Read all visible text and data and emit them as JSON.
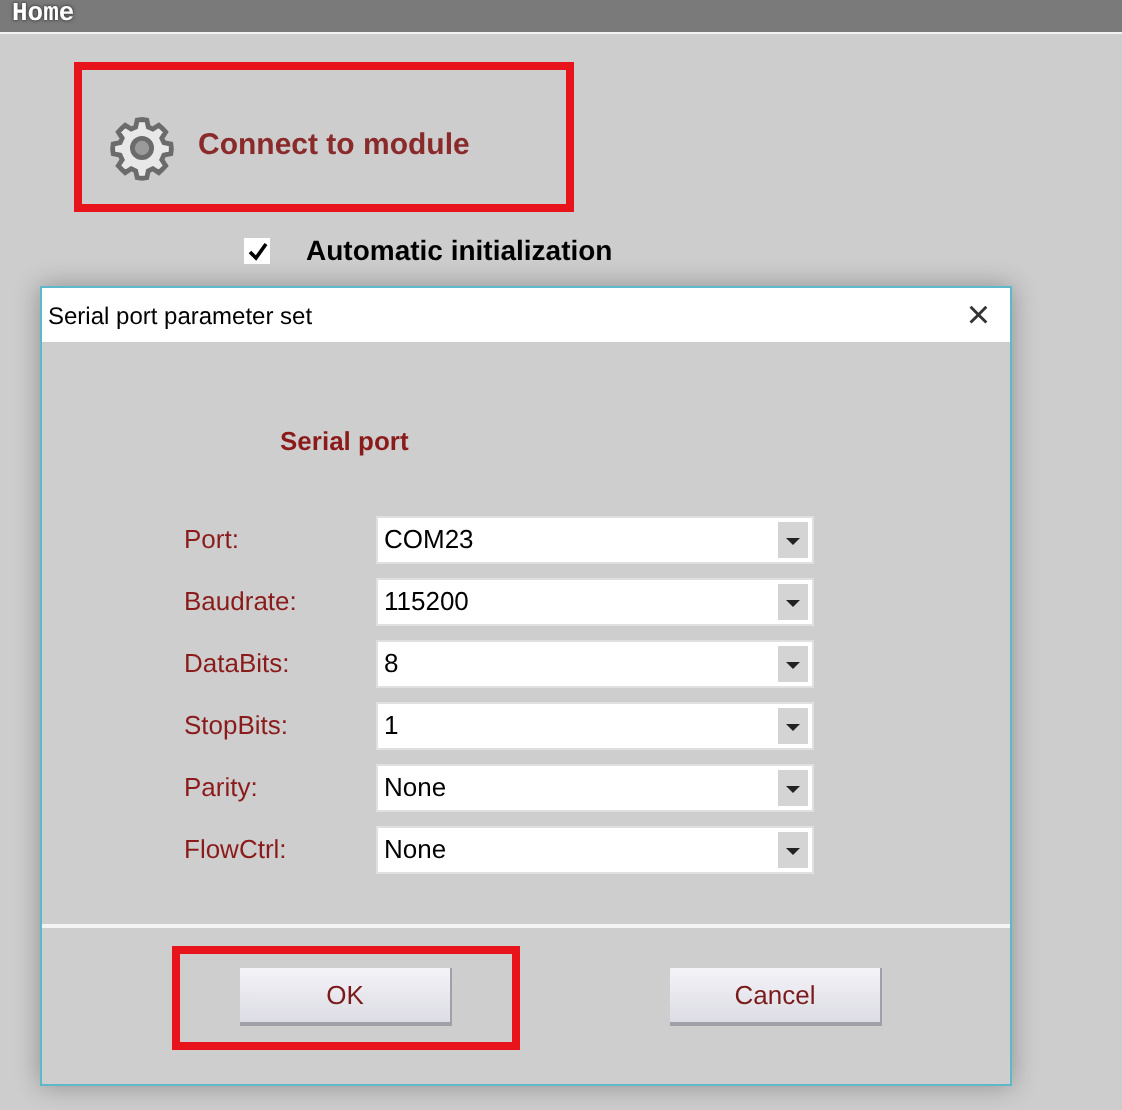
{
  "header": {
    "title": "Home"
  },
  "connect_button": {
    "label": "Connect to module",
    "highlighted": true
  },
  "auto_init": {
    "label": "Automatic initialization",
    "checked": true
  },
  "dialog": {
    "title": "Serial port parameter set",
    "close": "×",
    "section_title": "Serial port",
    "fields": [
      {
        "label": "Port:",
        "value": "COM23"
      },
      {
        "label": "Baudrate:",
        "value": "115200"
      },
      {
        "label": "DataBits:",
        "value": "8"
      },
      {
        "label": "StopBits:",
        "value": "1"
      },
      {
        "label": "Parity:",
        "value": "None"
      },
      {
        "label": "FlowCtrl:",
        "value": "None"
      }
    ],
    "buttons": [
      {
        "label": "OK",
        "highlighted": true
      },
      {
        "label": "Cancel",
        "highlighted": false
      }
    ]
  }
}
